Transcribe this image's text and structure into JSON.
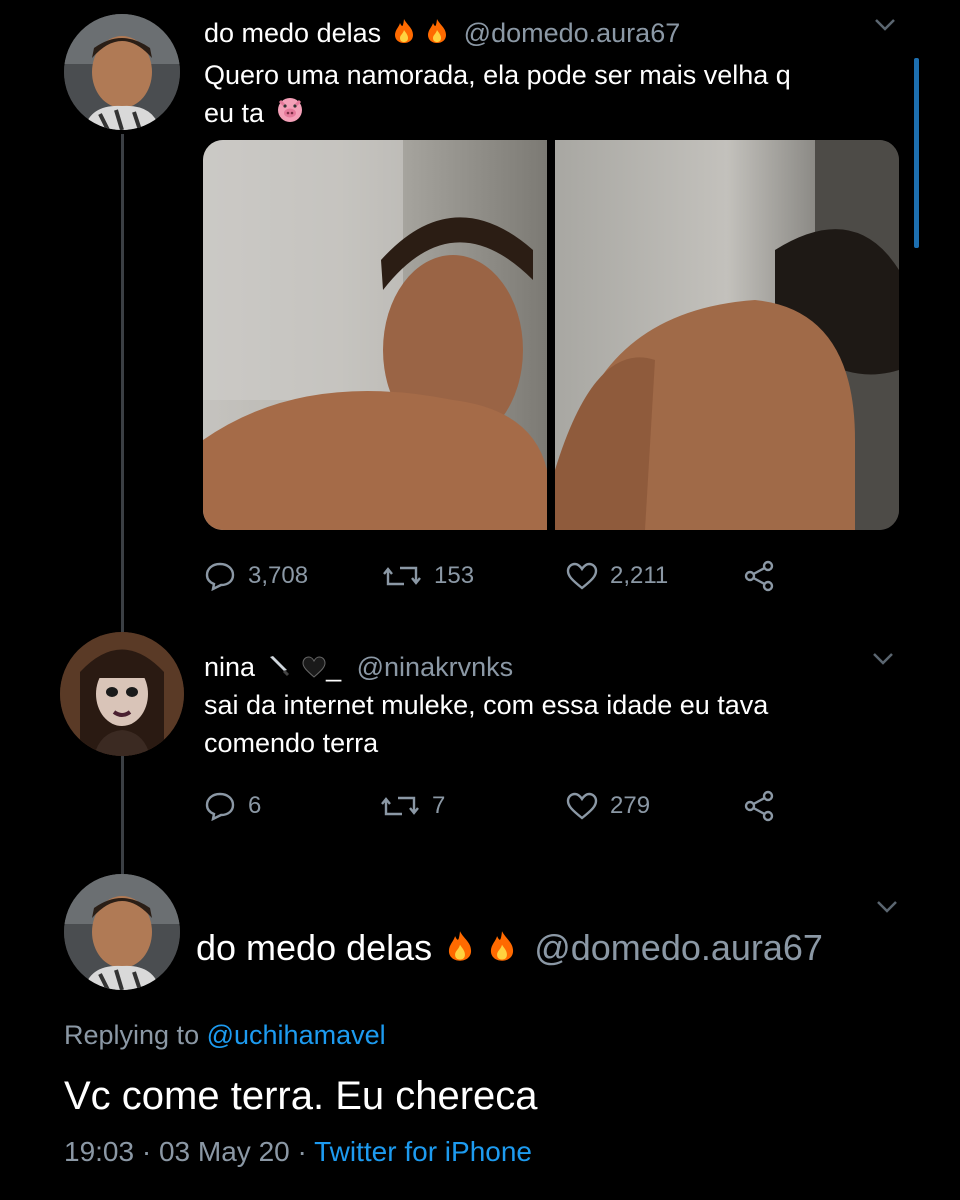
{
  "tweet1": {
    "name": "do medo delas",
    "name_emojis": [
      "fire-emoji",
      "fire-emoji"
    ],
    "handle": "@domedo.aura67",
    "text_line1": "Quero uma namorada, ela pode ser mais velha q",
    "text_line2": "eu ta",
    "text_emoji": "pig-face-emoji",
    "stats": {
      "replies": "3,708",
      "retweets": "153",
      "likes": "2,211"
    }
  },
  "tweet2": {
    "name": "nina",
    "name_emojis": [
      "knife-emoji",
      "black-heart-emoji"
    ],
    "name_suffix": "_",
    "handle": "@ninakrvnks",
    "text_line1": "sai da internet muleke, com essa idade eu tava",
    "text_line2": "comendo terra",
    "stats": {
      "replies": "6",
      "retweets": "7",
      "likes": "279"
    }
  },
  "tweet3": {
    "name": "do medo delas",
    "name_emojis": [
      "fire-emoji",
      "fire-emoji"
    ],
    "handle": "@domedo.aura67",
    "replying_prefix": "Replying to",
    "replying_to": "@uchihamavel",
    "text": "Vc come terra.  Eu chereca",
    "time": "19:03",
    "date": "03 May 20",
    "source": "Twitter for iPhone",
    "separator": "·"
  },
  "colors": {
    "background": "#000000",
    "text": "#ffffff",
    "secondary": "#8b98a5",
    "link": "#1d9bf0"
  }
}
